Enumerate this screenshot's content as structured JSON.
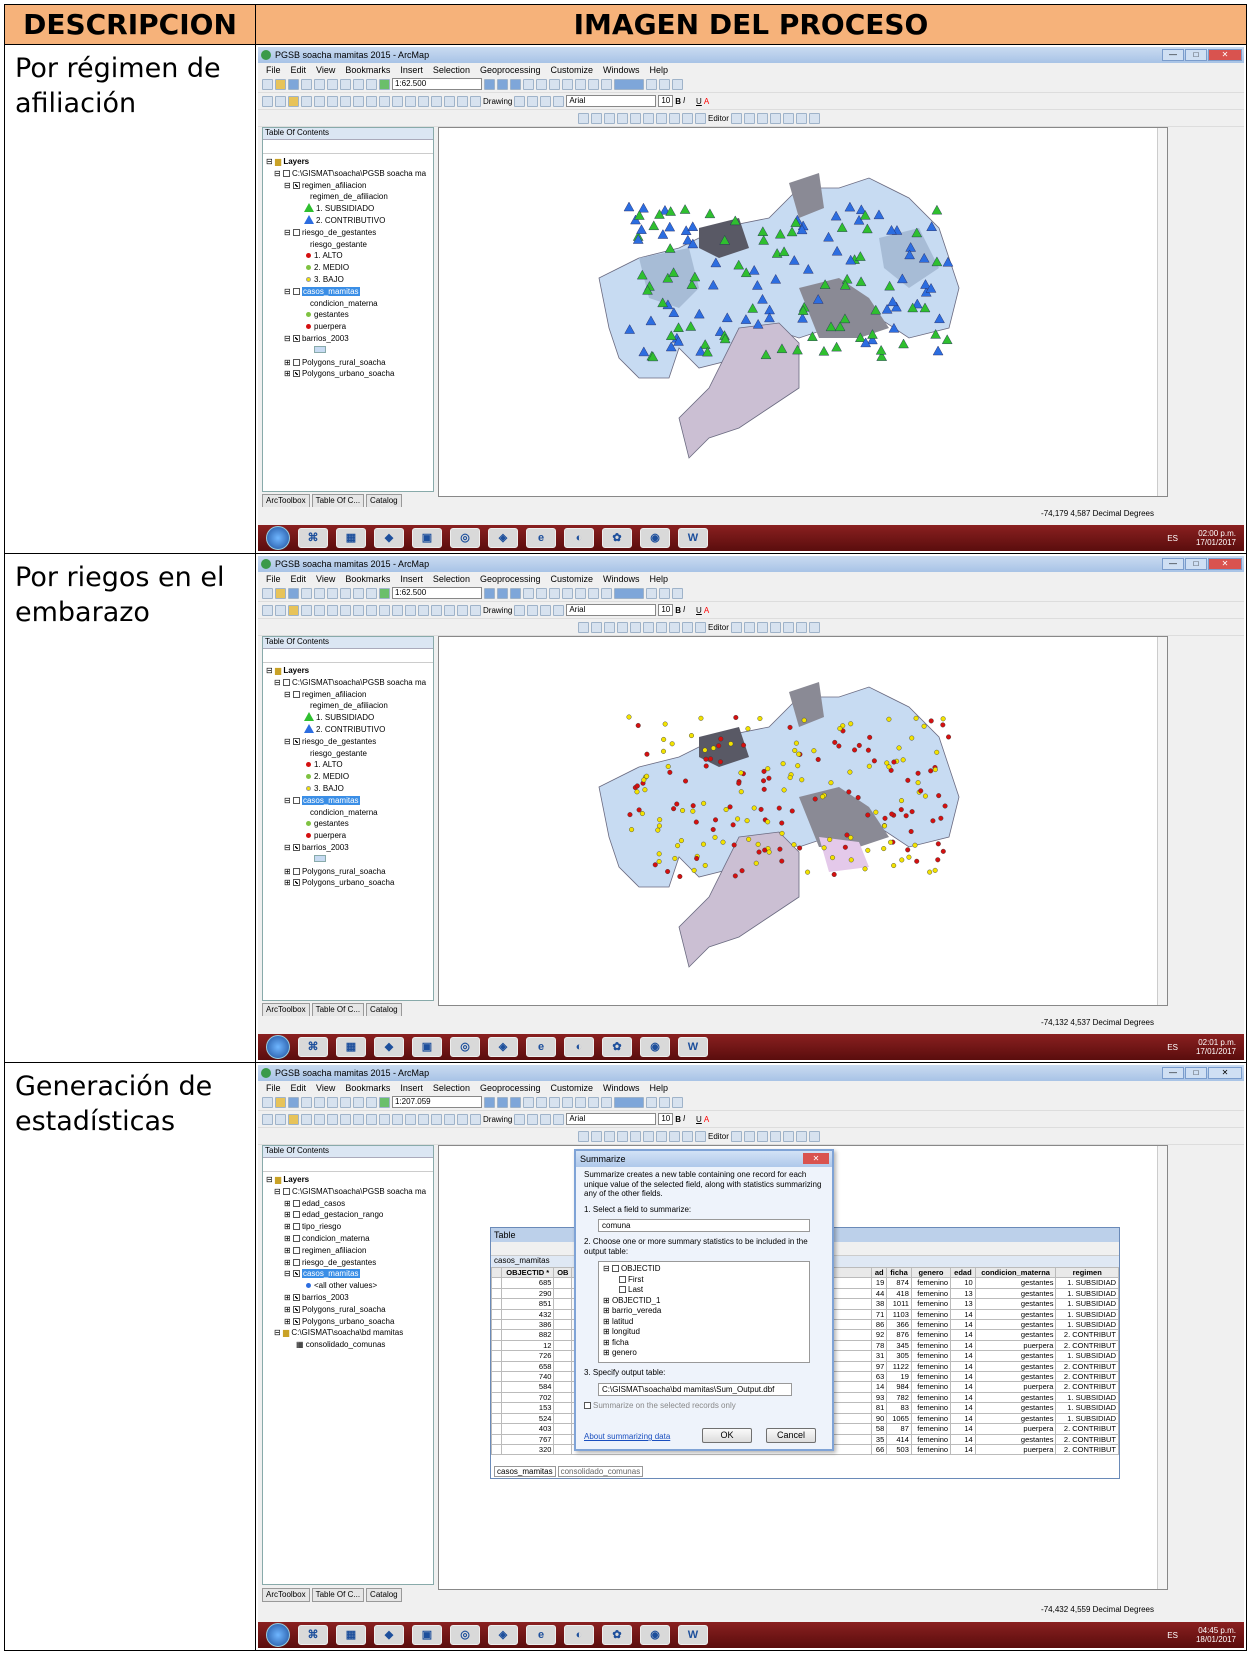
{
  "header": {
    "col1": "DESCRIPCION",
    "col2": "IMAGEN DEL PROCESO"
  },
  "rows": [
    {
      "desc": "Por régimen de afiliación"
    },
    {
      "desc": "Por riegos en el embarazo"
    },
    {
      "desc": "Generación de estadísticas"
    }
  ],
  "app": {
    "title": "PGSB soacha mamitas 2015 - ArcMap",
    "menu": [
      "File",
      "Edit",
      "View",
      "Bookmarks",
      "Insert",
      "Selection",
      "Geoprocessing",
      "Customize",
      "Windows",
      "Help"
    ],
    "scale1": "1:62.500",
    "scale3": "1:207.059",
    "drawing": "Drawing",
    "font": "Arial",
    "fontsize": "10",
    "editor": "Editor",
    "toc_title": "Table Of Contents",
    "tabs": [
      "ArcToolbox",
      "Table Of C...",
      "Catalog"
    ]
  },
  "toc1": {
    "layers": "Layers",
    "path": "C:\\GISMAT\\soacha\\PGSB soacha ma",
    "regimen": "regimen_afiliacion",
    "regimen_field": "regimen_de_afiliacion",
    "sub": "1. SUBSIDIADO",
    "con": "2. CONTRIBUTIVO",
    "riesgo": "riesgo_de_gestantes",
    "riesgo_field": "riesgo_gestante",
    "alto": "1. ALTO",
    "medio": "2. MEDIO",
    "bajo": "3. BAJO",
    "casos": "casos_mamitas",
    "cond": "condicion_materna",
    "gest": "gestantes",
    "puer": "puerpera",
    "barrios": "barrios_2003",
    "rural": "Polygons_rural_soacha",
    "urbano": "Polygons_urbano_soacha"
  },
  "toc3": [
    "edad_casos",
    "edad_gestacion_rango",
    "tipo_riesgo",
    "condicion_materna",
    "regimen_afiliacion",
    "riesgo_de_gestantes",
    "casos_mamitas",
    "<all other values>",
    "barrios_2003",
    "Polygons_rural_soacha",
    "Polygons_urbano_soacha",
    "C:\\GISMAT\\soacha\\bd mamitas",
    "consolidado_comunas"
  ],
  "status": {
    "s1": "-74,179  4,587 Decimal Degrees",
    "s2": "-74,132  4,537 Decimal Degrees",
    "s3": "-74,432  4,559 Decimal Degrees"
  },
  "clock": {
    "c1t": "02:00 p.m.",
    "c1d": "17/01/2017",
    "c2t": "02:01 p.m.",
    "c2d": "17/01/2017",
    "c3t": "04:45 p.m.",
    "c3d": "18/01/2017",
    "lang": "ES"
  },
  "dialog": {
    "title": "Summarize",
    "intro": "Summarize creates a new table containing one record for each unique value of the selected field, along with statistics summarizing any of the other fields.",
    "step1": "1.  Select a field to summarize:",
    "field": "comuna",
    "step2": "2.  Choose one or more summary statistics to be included in the output table:",
    "list": [
      "OBJECTID",
      "First",
      "Last",
      "OBJECTID_1",
      "barrio_vereda",
      "latitud",
      "longitud",
      "ficha",
      "genero"
    ],
    "step3": "3.  Specify output table:",
    "out": "C:\\GISMAT\\soacha\\bd mamitas\\Sum_Output.dbf",
    "sel": "Summarize on the selected records only",
    "about": "About summarizing data",
    "ok": "OK",
    "cancel": "Cancel"
  },
  "table": {
    "title": "Table",
    "layer": "casos_mamitas",
    "cols": [
      "OBJECTID *",
      "OB",
      "ad",
      "ficha",
      "genero",
      "edad",
      "condicion_materna",
      "regimen"
    ],
    "rows": [
      [
        "685",
        "19",
        "874",
        "femenino",
        "10",
        "gestantes",
        "1. SUBSIDIAD"
      ],
      [
        "290",
        "44",
        "418",
        "femenino",
        "13",
        "gestantes",
        "1. SUBSIDIAD"
      ],
      [
        "851",
        "38",
        "1011",
        "femenino",
        "13",
        "gestantes",
        "1. SUBSIDIAD"
      ],
      [
        "432",
        "71",
        "1103",
        "femenino",
        "14",
        "gestantes",
        "1. SUBSIDIAD"
      ],
      [
        "386",
        "86",
        "366",
        "femenino",
        "14",
        "gestantes",
        "1. SUBSIDIAD"
      ],
      [
        "882",
        "92",
        "876",
        "femenino",
        "14",
        "gestantes",
        "2. CONTRIBUT"
      ],
      [
        "12",
        "78",
        "345",
        "femenino",
        "14",
        "puerpera",
        "2. CONTRIBUT"
      ],
      [
        "726",
        "31",
        "305",
        "femenino",
        "14",
        "gestantes",
        "1. SUBSIDIAD"
      ],
      [
        "658",
        "97",
        "1122",
        "femenino",
        "14",
        "gestantes",
        "2. CONTRIBUT"
      ],
      [
        "740",
        "63",
        "19",
        "femenino",
        "14",
        "gestantes",
        "2. CONTRIBUT"
      ],
      [
        "584",
        "14",
        "984",
        "femenino",
        "14",
        "puerpera",
        "2. CONTRIBUT"
      ],
      [
        "702",
        "93",
        "782",
        "femenino",
        "14",
        "gestantes",
        "1. SUBSIDIAD"
      ],
      [
        "153",
        "81",
        "83",
        "femenino",
        "14",
        "gestantes",
        "1. SUBSIDIAD"
      ],
      [
        "524",
        "90",
        "1065",
        "femenino",
        "14",
        "gestantes",
        "1. SUBSIDIAD"
      ],
      [
        "403",
        "58",
        "87",
        "femenino",
        "14",
        "puerpera",
        "2. CONTRIBUT"
      ],
      [
        "767",
        "35",
        "414",
        "femenino",
        "14",
        "gestantes",
        "2. CONTRIBUT"
      ],
      [
        "320",
        "66",
        "503",
        "femenino",
        "14",
        "puerpera",
        "2. CONTRIBUT"
      ]
    ],
    "tabs": [
      "casos_mamitas",
      "consolidado_comunas"
    ]
  },
  "colors": {
    "header": "#f6b27a",
    "subsidiado": "#2fbf2f",
    "contributivo": "#2c6de0",
    "alto": "#d41010",
    "medio": "#7fc241",
    "bajo": "#f2e200",
    "taskbar": "#7a1a1a"
  }
}
